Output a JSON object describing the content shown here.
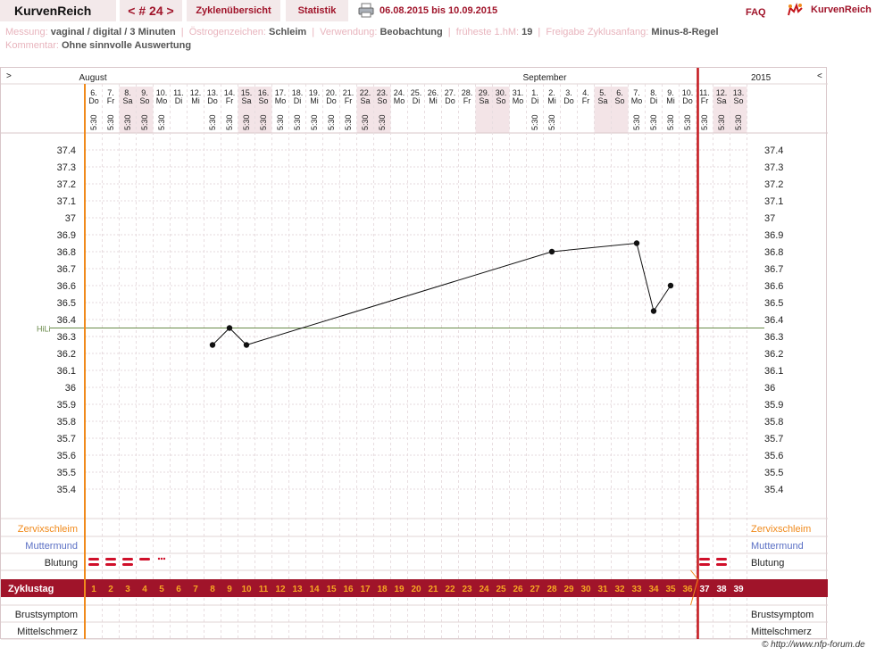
{
  "header": {
    "brand": "KurvenReich",
    "cycle_nav": "< # 24 >",
    "tabs": [
      "Zyklenübersicht",
      "Statistik"
    ],
    "date_range": "06.08.2015 bis 10.09.2015",
    "faq": "FAQ",
    "logo_text": "KurvenReich",
    "icons": [
      "printer-icon",
      "kurvenreich-logo-icon"
    ]
  },
  "info": {
    "measurement_label": "Messung:",
    "measurement_value": "vaginal / digital / 3 Minuten",
    "estrogen_label": "Östrogenzeichen:",
    "estrogen_value": "Schleim",
    "usage_label": "Verwendung:",
    "usage_value": "Beobachtung",
    "earliest_label": "früheste 1.hM:",
    "earliest_value": "19",
    "release_label": "Freigabe Zyklusanfang:",
    "release_value": "Minus-8-Regel",
    "comment_label": "Kommentar:",
    "comment_value": "Ohne sinnvolle Auswertung"
  },
  "chart_data": {
    "type": "line",
    "left_arrow": ">",
    "right_arrow": "<",
    "year": "2015",
    "months": [
      {
        "name": "August",
        "start_index": 0
      },
      {
        "name": "September",
        "start_index": 26
      }
    ],
    "dates": [
      "6.",
      "7.",
      "8.",
      "9.",
      "10.",
      "11.",
      "12.",
      "13.",
      "14.",
      "15.",
      "16.",
      "17.",
      "18.",
      "19.",
      "20.",
      "21.",
      "22.",
      "23.",
      "24.",
      "25.",
      "26.",
      "27.",
      "28.",
      "29.",
      "30.",
      "31.",
      "1.",
      "2.",
      "3.",
      "4.",
      "5.",
      "6.",
      "7.",
      "8.",
      "9.",
      "10.",
      "11.",
      "12.",
      "13."
    ],
    "weekdays": [
      "Do",
      "Fr",
      "Sa",
      "So",
      "Mo",
      "Di",
      "Mi",
      "Do",
      "Fr",
      "Sa",
      "So",
      "Mo",
      "Di",
      "Mi",
      "Do",
      "Fr",
      "Sa",
      "So",
      "Mo",
      "Di",
      "Mi",
      "Do",
      "Fr",
      "Sa",
      "So",
      "Mo",
      "Di",
      "Mi",
      "Do",
      "Fr",
      "Sa",
      "So",
      "Mo",
      "Di",
      "Mi",
      "Do",
      "Fr",
      "Sa",
      "So"
    ],
    "times": [
      "5:30",
      "5:30",
      "5:30",
      "5:30",
      "5:30",
      "",
      "",
      "5:30",
      "5:30",
      "5:30",
      "5:30",
      "5:30",
      "5:30",
      "5:30",
      "5:30",
      "5:30",
      "5:30",
      "5:30",
      "",
      "",
      "",
      "",
      "",
      "",
      "",
      "",
      "5:30",
      "5:30",
      "",
      "",
      "",
      "",
      "5:30",
      "5:30",
      "5:30",
      "5:30",
      "5:30",
      "5:30",
      "5:30"
    ],
    "shaded_days": [
      2,
      3,
      9,
      10,
      16,
      17,
      23,
      24,
      30,
      31,
      37,
      38
    ],
    "y_ticks": [
      "37.4",
      "37.3",
      "37.2",
      "37.1",
      "37",
      "36.9",
      "36.8",
      "36.7",
      "36.6",
      "36.5",
      "36.4",
      "36.3",
      "36.2",
      "36.1",
      "36",
      "35.9",
      "35.8",
      "35.7",
      "35.6",
      "35.5",
      "35.4"
    ],
    "ylim": [
      35.4,
      37.4
    ],
    "hili_label": "HiLi",
    "hili_value": 36.35,
    "temperature_points": [
      {
        "cycle_day": 8,
        "value": 36.25
      },
      {
        "cycle_day": 9,
        "value": 36.35
      },
      {
        "cycle_day": 10,
        "value": 36.25
      },
      {
        "cycle_day": 28,
        "value": 36.8
      },
      {
        "cycle_day": 33,
        "value": 36.85
      },
      {
        "cycle_day": 34,
        "value": 36.45
      },
      {
        "cycle_day": 35,
        "value": 36.6
      }
    ],
    "rows": {
      "cervical": "Zervixschleim",
      "cervix": "Muttermund",
      "bleeding": "Blutung",
      "cycle_day": "Zyklustag",
      "breast": "Brustsymptom",
      "midpain": "Mittelschmerz"
    },
    "bleeding_marks": [
      {
        "cycle_day": 1,
        "kind": "heavy"
      },
      {
        "cycle_day": 2,
        "kind": "heavy"
      },
      {
        "cycle_day": 3,
        "kind": "heavy"
      },
      {
        "cycle_day": 4,
        "kind": "light"
      },
      {
        "cycle_day": 5,
        "kind": "spotting"
      },
      {
        "cycle_day": 37,
        "kind": "heavy"
      },
      {
        "cycle_day": 38,
        "kind": "heavy"
      }
    ],
    "cycle_days": [
      "1",
      "2",
      "3",
      "4",
      "5",
      "6",
      "7",
      "8",
      "9",
      "10",
      "11",
      "12",
      "13",
      "14",
      "15",
      "16",
      "17",
      "18",
      "19",
      "20",
      "21",
      "22",
      "23",
      "24",
      "25",
      "26",
      "27",
      "28",
      "29",
      "30",
      "31",
      "32",
      "33",
      "34",
      "35",
      "36",
      "37",
      "38",
      "39"
    ],
    "cycle_end_day": 36,
    "colors": {
      "accent": "#a0142a",
      "cycle_start": "#f08a1c",
      "cycle_end": "#c4161c",
      "hili": "#6a8a4a",
      "cervical_text": "#f08a1c",
      "cervix_text": "#5a6fc4",
      "day_number": "#f5a623",
      "shade": "#f3e4e7"
    }
  },
  "footer": {
    "copyright": "© http://www.nfp-forum.de"
  }
}
